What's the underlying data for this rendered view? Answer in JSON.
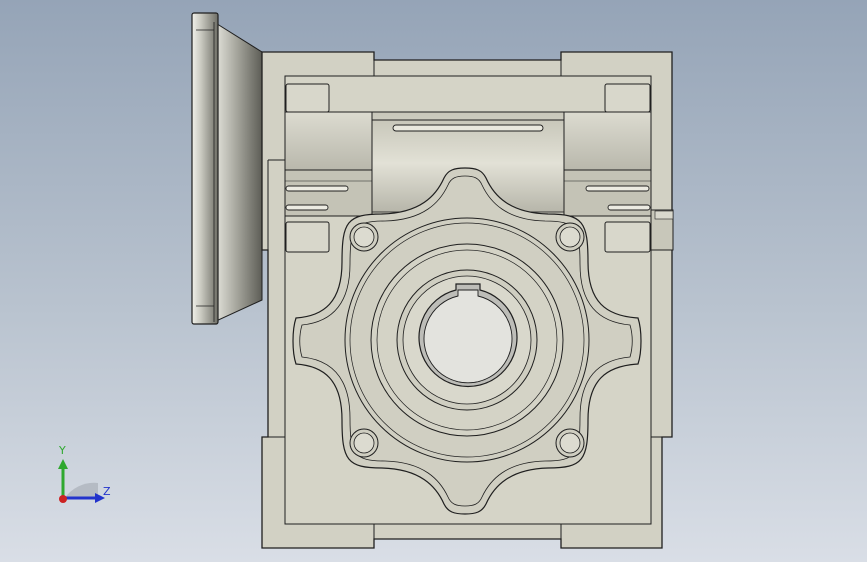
{
  "viewport": {
    "background_top": "#95a4b7",
    "background_bottom": "#d9dee6"
  },
  "model": {
    "body_fill": "#d2d1c4",
    "body_shade": "#bdbcaf",
    "edge_color": "#1f1f1f",
    "bore_fill": "#b8b8b4"
  },
  "triad": {
    "y_label": "Y",
    "z_label": "Z",
    "y_color": "#2fa82f",
    "z_color": "#2233cc",
    "x_color": "#cc2222"
  }
}
